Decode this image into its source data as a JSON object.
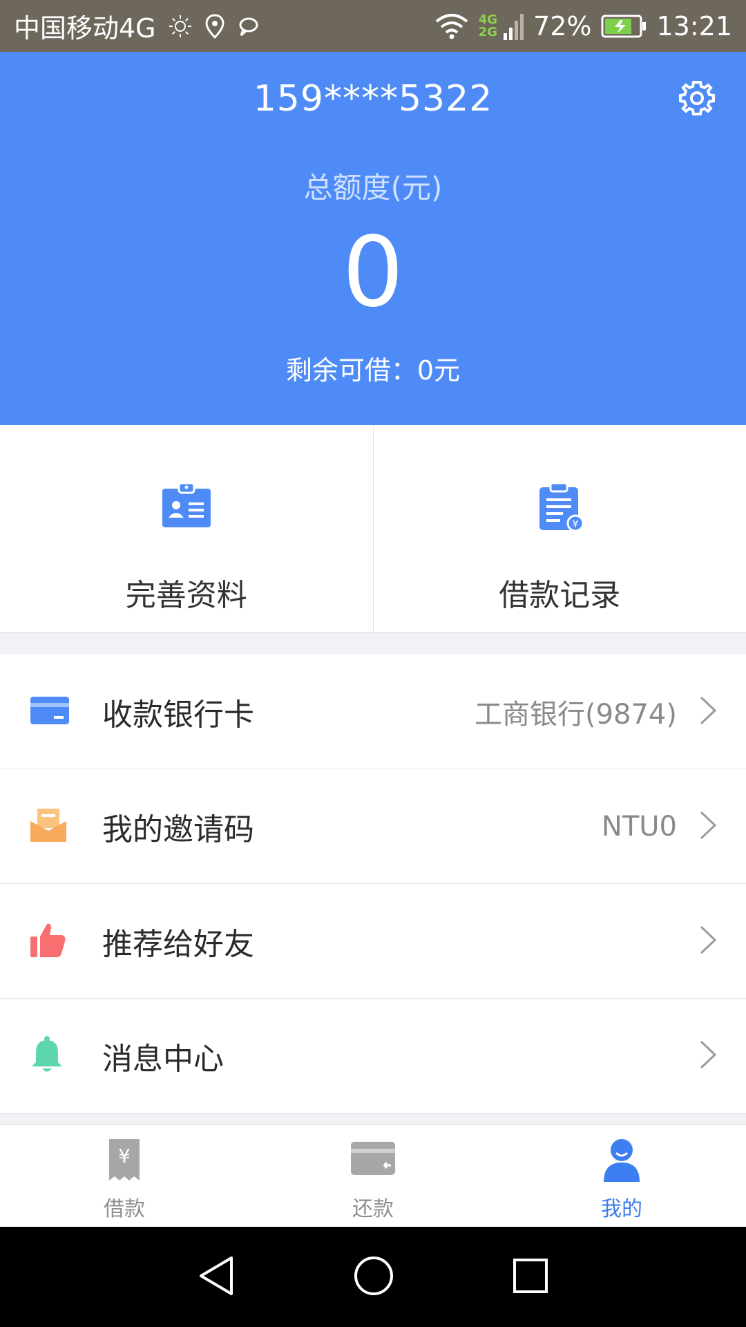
{
  "status_bar": {
    "carrier": "中国移动4G",
    "net_4g": "4G",
    "net_2g": "2G",
    "battery": "72%",
    "time": "13:21"
  },
  "header": {
    "phone": "159****5322",
    "total_label": "总额度(元)",
    "total_value": "0",
    "remaining": "剩余可借：0元"
  },
  "actions": [
    {
      "label": "完善资料",
      "icon": "id-card-icon"
    },
    {
      "label": "借款记录",
      "icon": "clipboard-yuan-icon"
    }
  ],
  "menu": [
    {
      "label": "收款银行卡",
      "value": "工商银行(9874)",
      "icon": "bank-card-icon",
      "color": "#4e8bf7"
    },
    {
      "label": "我的邀请码",
      "value": "NTU0",
      "icon": "envelope-icon",
      "color": "#f9ab5b"
    },
    {
      "label": "推荐给好友",
      "value": "",
      "icon": "thumbs-up-icon",
      "color": "#f76f6f"
    },
    {
      "label": "消息中心",
      "value": "",
      "icon": "bell-icon",
      "color": "#5dd6ab"
    }
  ],
  "tabs": [
    {
      "label": "借款",
      "icon": "receipt-yuan-icon",
      "active": false
    },
    {
      "label": "还款",
      "icon": "card-return-icon",
      "active": false
    },
    {
      "label": "我的",
      "icon": "user-icon",
      "active": true
    }
  ],
  "colors": {
    "primary": "#4e8bf7",
    "tab_active": "#3d7ff0",
    "tab_inactive": "#8e8e8e"
  }
}
